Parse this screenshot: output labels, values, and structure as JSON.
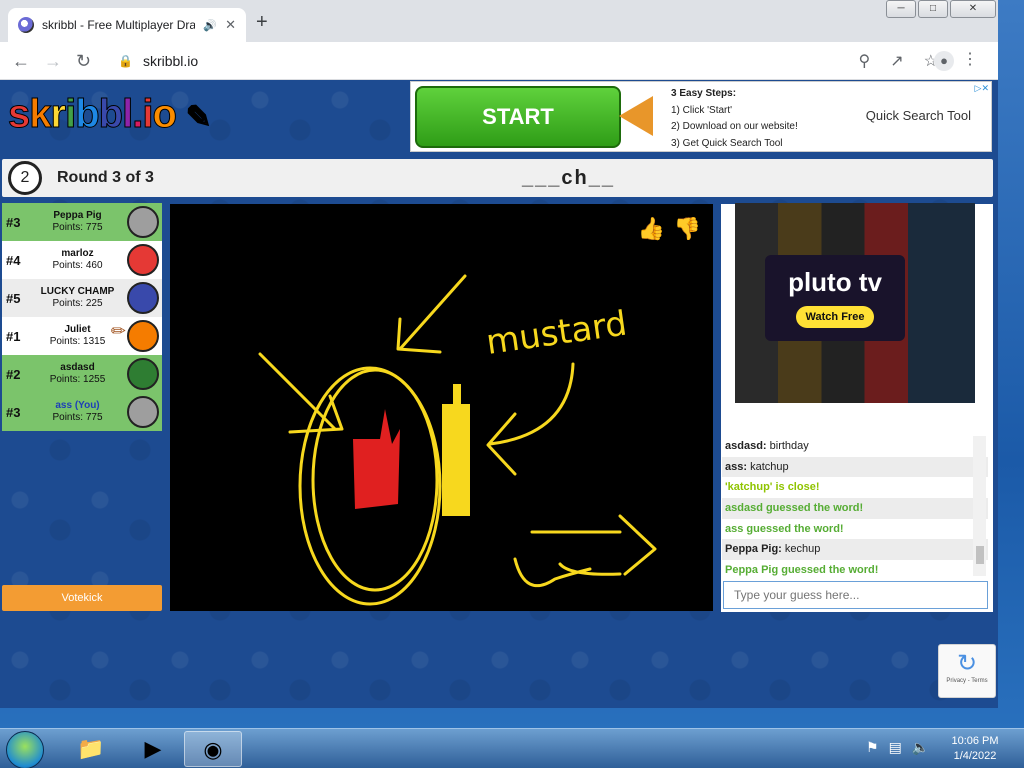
{
  "browser": {
    "tab_title": "skribbl - Free Multiplayer Dra",
    "url": "skribbl.io",
    "icons": [
      "audio-icon",
      "close-icon",
      "plus-icon",
      "back-icon",
      "forward-icon",
      "reload-icon",
      "lock-icon",
      "zoom-icon",
      "share-icon",
      "star-icon",
      "profile-icon",
      "menu-icon"
    ]
  },
  "logo": {
    "text": "skribbl.io"
  },
  "ad_top": {
    "start_label": "START",
    "steps_title": "3 Easy Steps:",
    "step1": "1) Click 'Start'",
    "step2": "2) Download on our website!",
    "step3": "3) Get Quick Search Tool",
    "product": "Quick Search Tool"
  },
  "game": {
    "timer": "2",
    "round": "Round 3 of 3",
    "word_hint": "___ch__"
  },
  "players": [
    {
      "rank": "#3",
      "name": "Peppa Pig",
      "points": "Points: 775",
      "color": "#7bc46b",
      "avatar": "#9e9e9e"
    },
    {
      "rank": "#4",
      "name": "marloz",
      "points": "Points: 460",
      "color": "#ffffff",
      "avatar": "#e53935"
    },
    {
      "rank": "#5",
      "name": "LUCKY CHAMP",
      "points": "Points: 225",
      "color": "#ececec",
      "avatar": "#3949ab"
    },
    {
      "rank": "#1",
      "name": "Juliet",
      "points": "Points: 1315",
      "color": "#ffffff",
      "avatar": "#f57c00"
    },
    {
      "rank": "#2",
      "name": "asdasd",
      "points": "Points: 1255",
      "color": "#7bc46b",
      "avatar": "#2e7d32"
    },
    {
      "rank": "#3",
      "name": "ass (You)",
      "points": "Points: 775",
      "color": "#7bc46b",
      "avatar": "#9e9e9e"
    }
  ],
  "votekick_label": "Votekick",
  "canvas": {
    "drawn_text": "mustard"
  },
  "ad_side": {
    "brand": "pluto tv",
    "cta": "Watch Free"
  },
  "chat": [
    {
      "who": "asdasd:",
      "text": "birthday",
      "type": "msg"
    },
    {
      "who": "ass:",
      "text": "katchup",
      "type": "msg"
    },
    {
      "who": "",
      "text": "'katchup' is close!",
      "type": "close"
    },
    {
      "who": "",
      "text": "asdasd guessed the word!",
      "type": "guessed"
    },
    {
      "who": "",
      "text": "ass guessed the word!",
      "type": "guessed"
    },
    {
      "who": "Peppa Pig:",
      "text": "kechup",
      "type": "msg"
    },
    {
      "who": "",
      "text": "Peppa Pig guessed the word!",
      "type": "guessed"
    }
  ],
  "guess_placeholder": "Type your guess here...",
  "recaptcha": {
    "text": "Privacy - Terms"
  },
  "taskbar": {
    "time": "10:06 PM",
    "date": "1/4/2022"
  }
}
